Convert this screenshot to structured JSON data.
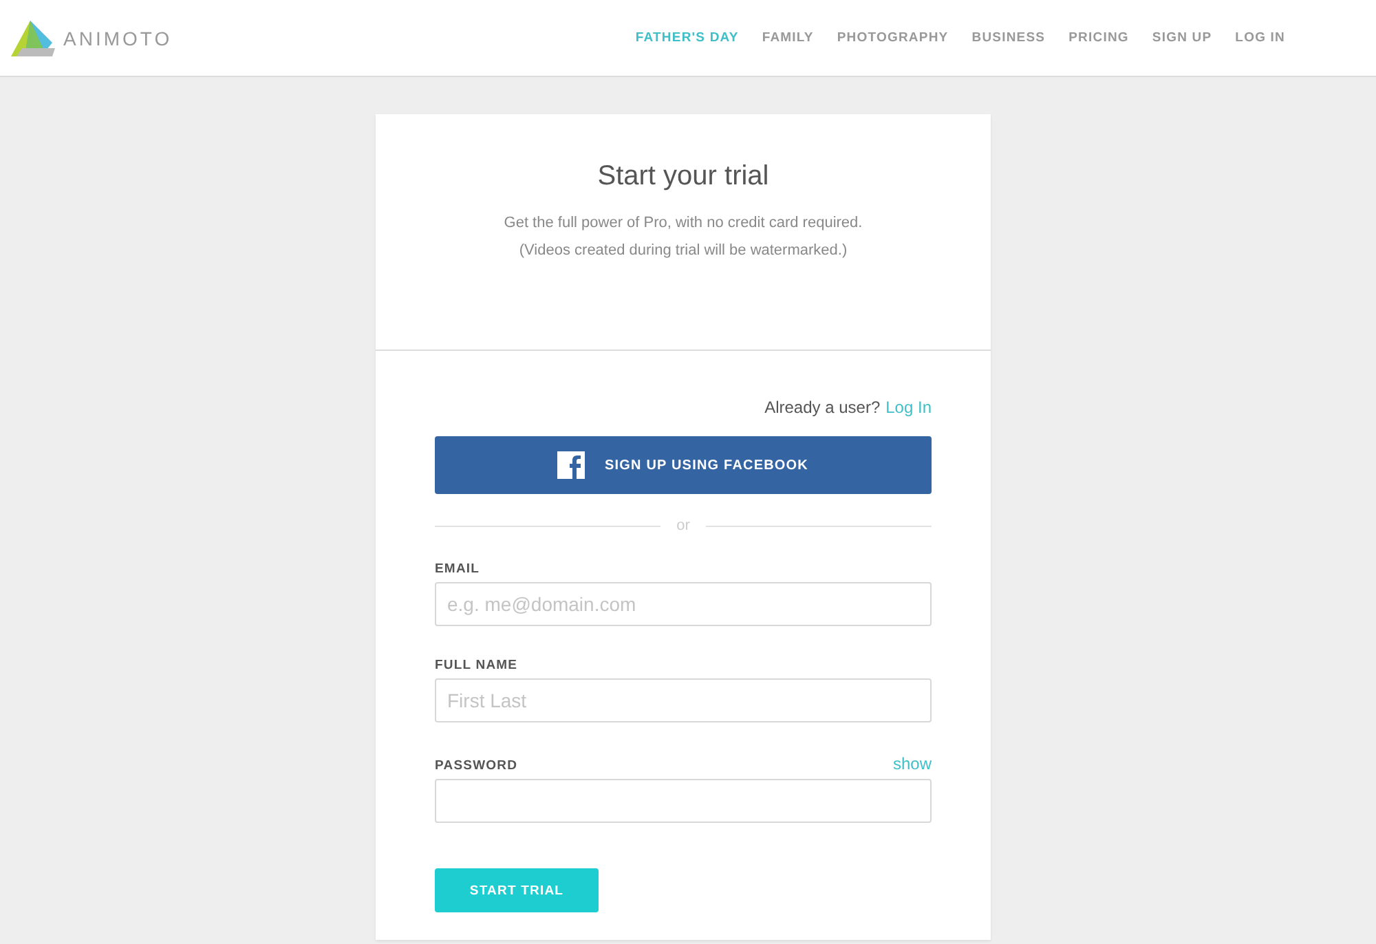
{
  "logo": {
    "text": "ANIMOTO"
  },
  "nav": [
    {
      "label": "FATHER'S DAY",
      "selected": true
    },
    {
      "label": "FAMILY",
      "selected": false
    },
    {
      "label": "PHOTOGRAPHY",
      "selected": false
    },
    {
      "label": "BUSINESS",
      "selected": false
    },
    {
      "label": "PRICING",
      "selected": false
    },
    {
      "label": "SIGN UP",
      "selected": false
    },
    {
      "label": "LOG IN",
      "selected": false
    }
  ],
  "card": {
    "title": "Start your trial",
    "subtitle": [
      "Get the full power of Pro, with no credit card required.",
      "(Videos created during trial will be watermarked.)"
    ],
    "login_prompt": "Already a user?",
    "login_link": "Log In",
    "facebook_button": "SIGN UP USING FACEBOOK",
    "divider": "or",
    "fields": [
      {
        "label": "EMAIL",
        "placeholder": "e.g. me@domain.com"
      },
      {
        "label": "FULL NAME",
        "placeholder": "First Last"
      },
      {
        "label": "PASSWORD",
        "action": "show"
      }
    ],
    "submit_button": "START TRIAL"
  }
}
